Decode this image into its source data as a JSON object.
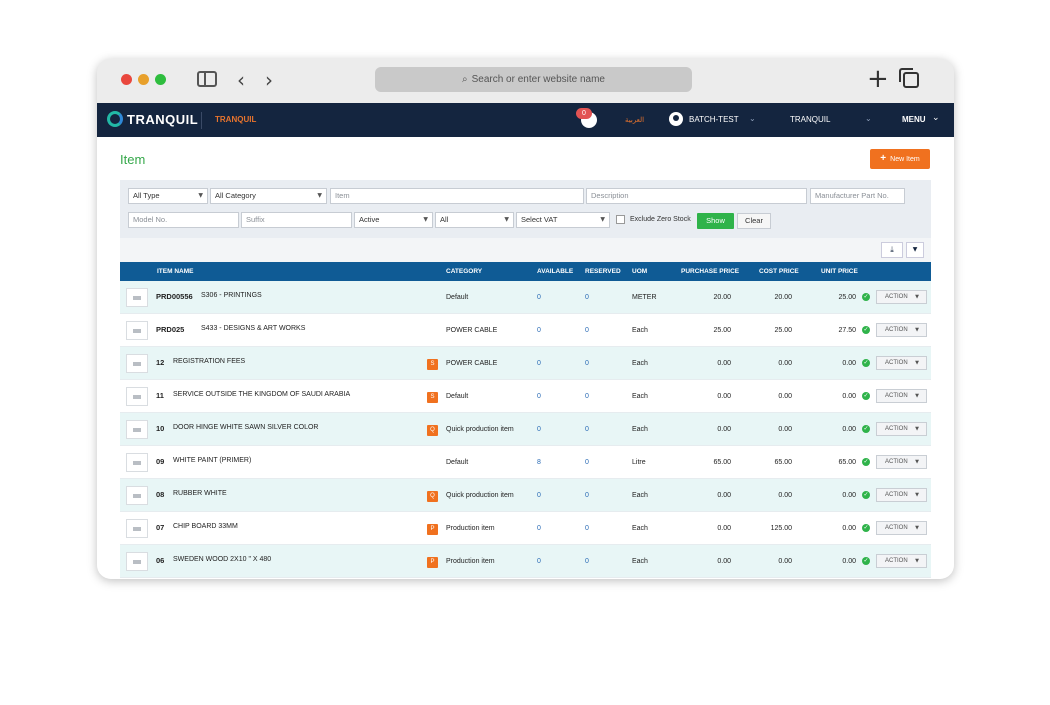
{
  "browser": {
    "url_placeholder": "Search or enter website name"
  },
  "nav": {
    "logo": "TRANQUIL",
    "company": "TRANQUIL",
    "notification_count": "0",
    "language": "العربية",
    "user": "BATCH-TEST",
    "tenant": "TRANQUIL",
    "menu": "MENU"
  },
  "page": {
    "title": "Item",
    "new_button": "New Item"
  },
  "filters": {
    "type": "All Type",
    "category": "All Category",
    "item_placeholder": "Item",
    "description_placeholder": "Description",
    "manufacturer_placeholder": "Manufacturer Part No.",
    "model_placeholder": "Model No.",
    "suffix_placeholder": "Suffix",
    "status": "Active",
    "all": "All",
    "vat": "Select VAT",
    "exclude_zero_stock": "Exclude Zero Stock",
    "show": "Show",
    "clear": "Clear"
  },
  "table": {
    "headers": {
      "item_name": "ITEM NAME",
      "category": "CATEGORY",
      "available": "AVAILABLE",
      "reserved": "RESERVED",
      "uom": "UOM",
      "purchase_price": "PURCHASE PRICE",
      "cost_price": "COST PRICE",
      "unit_price": "UNIT PRICE"
    },
    "action_label": "ACTION",
    "rows": [
      {
        "code": "PRD00556",
        "name": "S306 - PRINTINGS",
        "badge": "",
        "category": "Default",
        "available": "0",
        "reserved": "0",
        "uom": "METER",
        "purchase": "20.00",
        "cost": "20.00",
        "unit": "25.00"
      },
      {
        "code": "PRD025",
        "name": "S433 - DESIGNS & ART WORKS",
        "badge": "",
        "category": "POWER CABLE",
        "available": "0",
        "reserved": "0",
        "uom": "Each",
        "purchase": "25.00",
        "cost": "25.00",
        "unit": "27.50"
      },
      {
        "code": "12",
        "name": "REGISTRATION FEES",
        "badge": "S",
        "category": "POWER CABLE",
        "available": "0",
        "reserved": "0",
        "uom": "Each",
        "purchase": "0.00",
        "cost": "0.00",
        "unit": "0.00"
      },
      {
        "code": "11",
        "name": "SERVICE OUTSIDE THE KINGDOM OF SAUDI ARABIA",
        "badge": "S",
        "category": "Default",
        "available": "0",
        "reserved": "0",
        "uom": "Each",
        "purchase": "0.00",
        "cost": "0.00",
        "unit": "0.00"
      },
      {
        "code": "10",
        "name": "DOOR HINGE WHITE SAWN SILVER COLOR",
        "badge": "Q",
        "category": "Quick production item",
        "available": "0",
        "reserved": "0",
        "uom": "Each",
        "purchase": "0.00",
        "cost": "0.00",
        "unit": "0.00"
      },
      {
        "code": "09",
        "name": "WHITE PAINT (PRIMER)",
        "badge": "",
        "category": "Default",
        "available": "8",
        "reserved": "0",
        "uom": "Litre",
        "purchase": "65.00",
        "cost": "65.00",
        "unit": "65.00"
      },
      {
        "code": "08",
        "name": "RUBBER WHITE",
        "badge": "Q",
        "category": "Quick production item",
        "available": "0",
        "reserved": "0",
        "uom": "Each",
        "purchase": "0.00",
        "cost": "0.00",
        "unit": "0.00"
      },
      {
        "code": "07",
        "name": "CHIP BOARD 33MM",
        "badge": "P",
        "category": "Production item",
        "available": "0",
        "reserved": "0",
        "uom": "Each",
        "purchase": "0.00",
        "cost": "125.00",
        "unit": "0.00"
      },
      {
        "code": "06",
        "name": "SWEDEN WOOD 2X10 \" X 480",
        "badge": "P",
        "category": "Production item",
        "available": "0",
        "reserved": "0",
        "uom": "Each",
        "purchase": "0.00",
        "cost": "0.00",
        "unit": "0.00"
      }
    ]
  }
}
